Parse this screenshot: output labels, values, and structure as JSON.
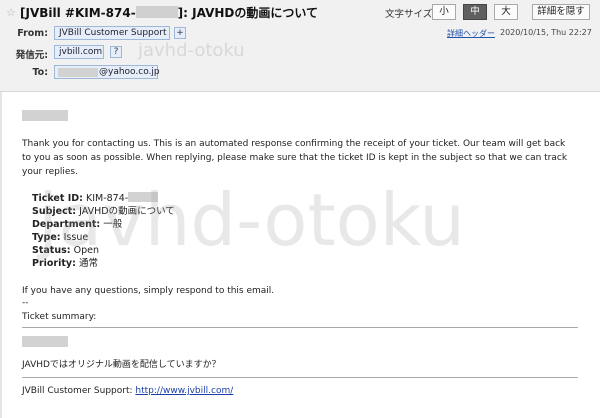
{
  "header": {
    "subject_prefix": "[JVBill #KIM-874-",
    "subject_suffix": "]: JAVHDの動画について",
    "font_size_label": "文字サイズ:",
    "font_sizes": [
      "小",
      "中",
      "大"
    ],
    "active_font_size": "中",
    "hide_details_label": "詳細を隠す",
    "from_label": "From:",
    "from_name": "JVBill Customer Support",
    "add_contact_label": "+",
    "sender_label": "発信元:",
    "sender_domain": "jvbill.com",
    "sender_help": "?",
    "to_label": "To:",
    "to_address_suffix": "@yahoo.co.jp",
    "details_header_link": "詳細ヘッダー",
    "datetime": "2020/10/15, Thu 22:27"
  },
  "message": {
    "intro": "Thank you for contacting us. This is an automated response confirming the receipt of your ticket. Our team will get back to you as soon as possible. When replying, please make sure that the ticket ID is kept in the subject so that we can track your replies.",
    "ticket": {
      "id_label": "Ticket ID:",
      "id_value": "KIM-874-",
      "subject_label": "Subject:",
      "subject_value": "JAVHDの動画について",
      "department_label": "Department:",
      "department_value": "一般",
      "type_label": "Type:",
      "type_value": "Issue",
      "status_label": "Status:",
      "status_value": "Open",
      "priority_label": "Priority:",
      "priority_value": "通常"
    },
    "closing": "If you have any questions, simply respond to this email.",
    "separator": "--",
    "summary_label": "Ticket summary:",
    "question": "JAVHDではオリジナル動画を配信していますか？",
    "signature_prefix": "JVBill Customer Support:",
    "signature_link": "http://www.jvbill.com/"
  },
  "watermark": {
    "large": "javhd-otoku",
    "small": "javhd-otoku"
  },
  "colors": {
    "header_bg": "#f1f1f1",
    "chip_bg": "#e6eef9",
    "link": "#1a3ea8",
    "active_size_bg": "#5f5f5f"
  },
  "icons": {
    "star": "star-icon",
    "add_contact": "plus-icon",
    "help": "question-icon"
  }
}
